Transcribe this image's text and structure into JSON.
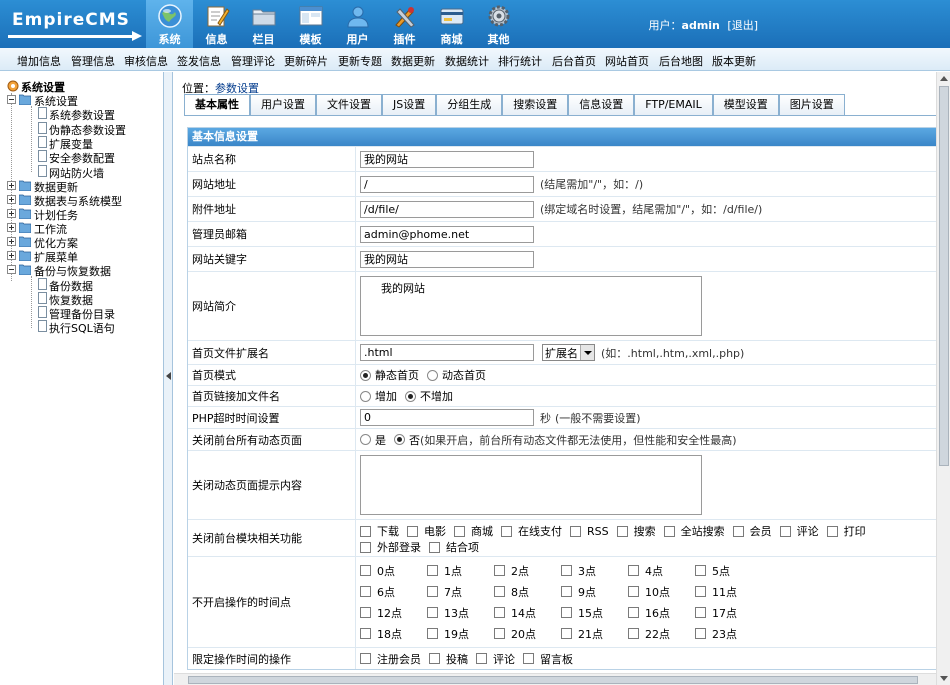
{
  "app": {
    "logo_text": "EmpireCMS",
    "user_label": "用户：",
    "username": "admin",
    "logout": "[退出]"
  },
  "main_nav": [
    {
      "label": "系统",
      "icon": "globe-icon",
      "active": true
    },
    {
      "label": "信息",
      "icon": "edit-pencil-icon"
    },
    {
      "label": "栏目",
      "icon": "folder-icon"
    },
    {
      "label": "模板",
      "icon": "template-window-icon"
    },
    {
      "label": "用户",
      "icon": "user-icon"
    },
    {
      "label": "插件",
      "icon": "tools-icon"
    },
    {
      "label": "商城",
      "icon": "card-icon"
    },
    {
      "label": "其他",
      "icon": "gear-icon"
    }
  ],
  "sub_nav": [
    "增加信息",
    "管理信息",
    "审核信息",
    "签发信息",
    "管理评论",
    "更新碎片",
    "更新专题",
    "数据更新",
    "数据统计",
    "排行统计",
    "后台首页",
    "网站首页",
    "后台地图",
    "版本更新"
  ],
  "sidebar": {
    "root": "系统设置",
    "groups": [
      {
        "label": "系统设置",
        "expanded": true,
        "children": [
          "系统参数设置",
          "伪静态参数设置",
          "扩展变量",
          "安全参数配置",
          "网站防火墙"
        ]
      },
      {
        "label": "数据更新"
      },
      {
        "label": "数据表与系统模型"
      },
      {
        "label": "计划任务"
      },
      {
        "label": "工作流"
      },
      {
        "label": "优化方案"
      },
      {
        "label": "扩展菜单"
      },
      {
        "label": "备份与恢复数据",
        "expanded": true,
        "children": [
          "备份数据",
          "恢复数据",
          "管理备份目录",
          "执行SQL语句"
        ]
      }
    ]
  },
  "breadcrumb": {
    "prefix": "位置：",
    "link": "参数设置"
  },
  "tabs": [
    "基本属性",
    "用户设置",
    "文件设置",
    "JS设置",
    "分组生成",
    "搜索设置",
    "信息设置",
    "FTP/EMAIL",
    "模型设置",
    "图片设置"
  ],
  "form": {
    "section_title": "基本信息设置",
    "site_name": {
      "label": "站点名称",
      "value": "我的网站"
    },
    "site_url": {
      "label": "网站地址",
      "value": "/",
      "hint": "(结尾需加\"/\"，如：/)"
    },
    "attach_url": {
      "label": "附件地址",
      "value": "/d/file/",
      "hint": "(绑定域名时设置，结尾需加\"/\"，如：/d/file/)"
    },
    "admin_email": {
      "label": "管理员邮箱",
      "value": "admin@phome.net"
    },
    "keywords": {
      "label": "网站关键字",
      "value": "我的网站"
    },
    "intro": {
      "label": "网站简介",
      "value": "我的网站"
    },
    "index_ext": {
      "label": "首页文件扩展名",
      "value": ".html",
      "select": "扩展名",
      "hint": "(如：.html,.htm,.xml,.php)"
    },
    "index_mode": {
      "label": "首页模式",
      "options": [
        "静态首页",
        "动态首页"
      ],
      "selected": 0
    },
    "index_link": {
      "label": "首页链接加文件名",
      "options": [
        "增加",
        "不增加"
      ],
      "selected": 1
    },
    "php_timeout": {
      "label": "PHP超时时间设置",
      "value": "0",
      "unit": "秒",
      "hint": "(一般不需要设置)"
    },
    "close_dynamic": {
      "label": "关闭前台所有动态页面",
      "yes": "是",
      "no": "否",
      "selected": 1,
      "hint": "(如果开启，前台所有动态文件都无法使用，但性能和安全性最高)"
    },
    "close_msg": {
      "label": "关闭动态页面提示内容",
      "value": ""
    },
    "close_modules": {
      "label": "关闭前台模块相关功能",
      "options": [
        "下载",
        "电影",
        "商城",
        "在线支付",
        "RSS",
        "搜索",
        "全站搜索",
        "会员",
        "评论",
        "打印",
        "外部登录",
        "结合项"
      ]
    },
    "closed_hours": {
      "label": "不开启操作的时间点",
      "hours": [
        "0点",
        "1点",
        "2点",
        "3点",
        "4点",
        "5点",
        "6点",
        "7点",
        "8点",
        "9点",
        "10点",
        "11点",
        "12点",
        "13点",
        "14点",
        "15点",
        "16点",
        "17点",
        "18点",
        "19点",
        "20点",
        "21点",
        "22点",
        "23点"
      ]
    },
    "limit_ops": {
      "label": "限定操作时间的操作",
      "options": [
        "注册会员",
        "投稿",
        "评论",
        "留言板"
      ]
    }
  }
}
